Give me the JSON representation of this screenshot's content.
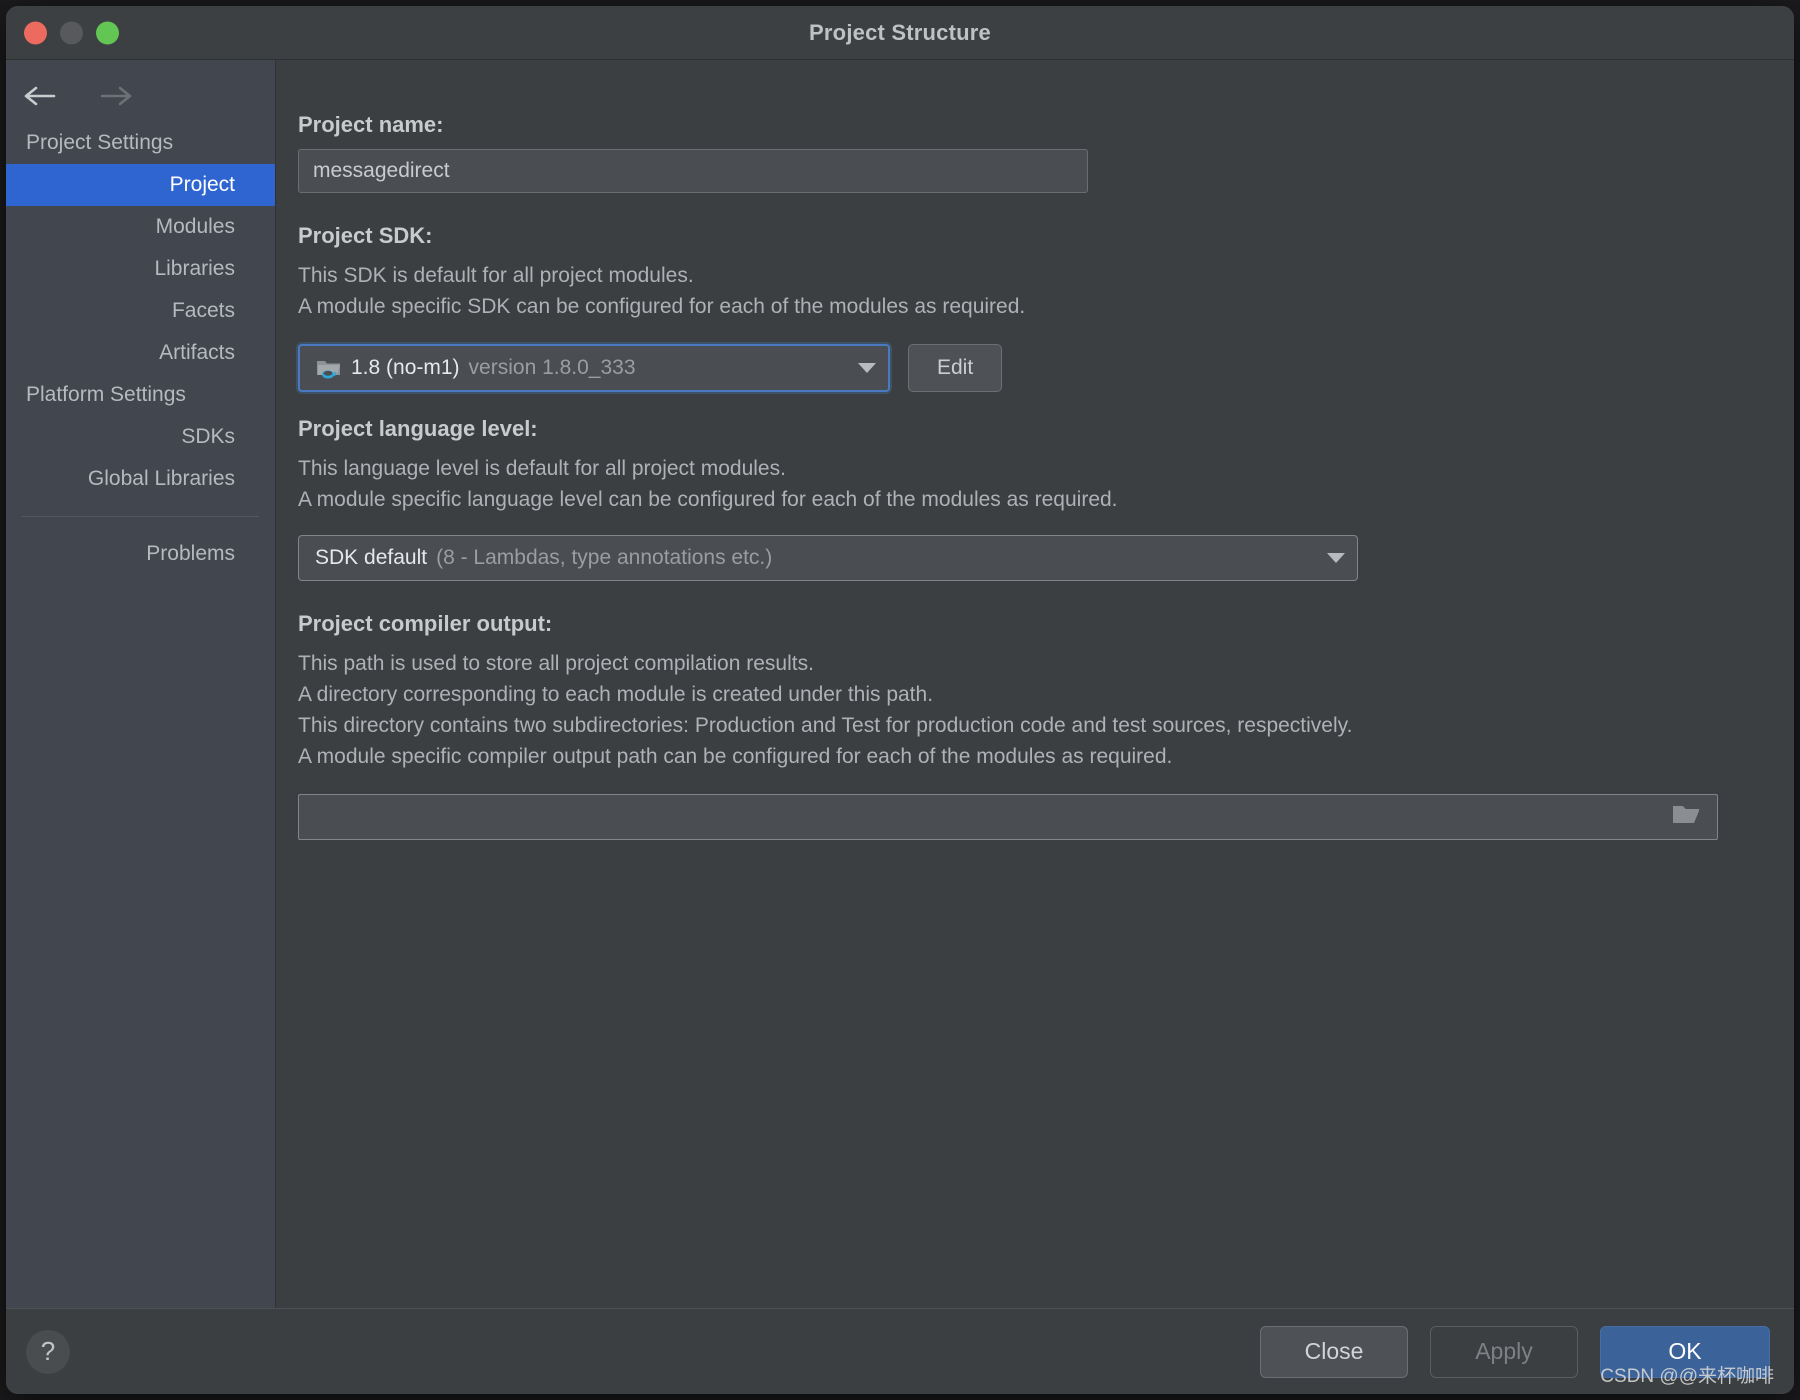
{
  "window": {
    "title": "Project Structure",
    "traffic_lights": [
      "close-red",
      "minimize-yellow",
      "zoom-green"
    ]
  },
  "nav": {
    "back_icon": "arrow-left-icon",
    "forward_icon": "arrow-right-icon"
  },
  "sidebar": {
    "groups": [
      {
        "header": "Project Settings",
        "items": [
          {
            "label": "Project",
            "selected": true
          },
          {
            "label": "Modules",
            "selected": false
          },
          {
            "label": "Libraries",
            "selected": false
          },
          {
            "label": "Facets",
            "selected": false
          },
          {
            "label": "Artifacts",
            "selected": false
          }
        ]
      },
      {
        "header": "Platform Settings",
        "items": [
          {
            "label": "SDKs",
            "selected": false
          },
          {
            "label": "Global Libraries",
            "selected": false
          }
        ]
      }
    ],
    "extra_items": [
      {
        "label": "Problems",
        "selected": false
      }
    ]
  },
  "main": {
    "project_name": {
      "label": "Project name:",
      "value": "messagedirect"
    },
    "project_sdk": {
      "label": "Project SDK:",
      "description_lines": [
        "This SDK is default for all project modules.",
        "A module specific SDK can be configured for each of the modules as required."
      ],
      "selected_main": "1.8 (no-m1)",
      "selected_sub": "version 1.8.0_333",
      "icon": "java-folder-icon",
      "edit_button": "Edit"
    },
    "language_level": {
      "label": "Project language level:",
      "description_lines": [
        "This language level is default for all project modules.",
        "A module specific language level can be configured for each of the modules as required."
      ],
      "selected_main": "SDK default",
      "selected_sub": "(8 - Lambdas, type annotations etc.)"
    },
    "compiler_output": {
      "label": "Project compiler output:",
      "description_lines": [
        "This path is used to store all project compilation results.",
        "A directory corresponding to each module is created under this path.",
        "This directory contains two subdirectories: Production and Test for production code and test sources, respectively.",
        "A module specific compiler output path can be configured for each of the modules as required."
      ],
      "value": "",
      "placeholder": "",
      "browse_icon": "open-folder-icon"
    }
  },
  "footer": {
    "help_label": "?",
    "close_label": "Close",
    "apply_label": "Apply",
    "ok_label": "OK"
  },
  "watermark": "CSDN @@来杯咖啡",
  "colors": {
    "accent_selected": "#2f65d0",
    "ok_button": "#3c6399",
    "focus_ring": "#4a79c0",
    "window_bg": "#3c3f41",
    "sidebar_bg": "#41464f"
  }
}
